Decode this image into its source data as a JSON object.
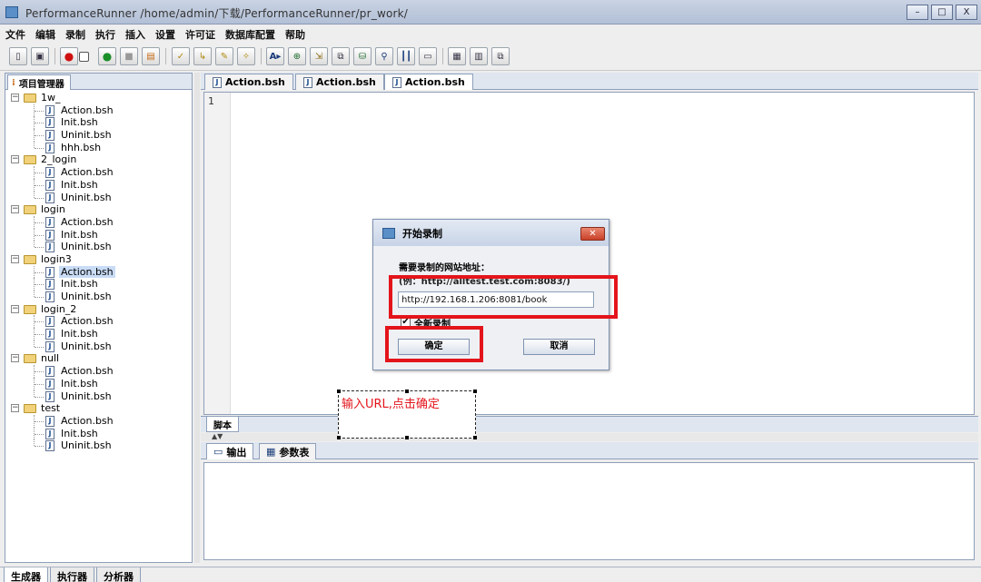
{
  "window": {
    "title": "PerformanceRunner  /home/admin/下载/PerformanceRunner/pr_work/",
    "controls": [
      "–",
      "□",
      "X"
    ]
  },
  "menu": [
    "文件",
    "编辑",
    "录制",
    "执行",
    "插入",
    "设置",
    "许可证",
    "数据库配置",
    "帮助"
  ],
  "toolbar": {
    "buttons": [
      "new-file-icon",
      "save-icon",
      "record-icon",
      "run-icon",
      "stop-icon",
      "export-icon",
      "check-icon",
      "transaction-icon",
      "rendezvous-icon",
      "think-time-icon",
      "text-check-icon",
      "parameter-icon",
      "insert-icon",
      "function-icon",
      "sql-icon",
      "link-icon",
      "chart-icon",
      "comment-icon",
      "properties-icon",
      "settings-icon",
      "copy-icon"
    ],
    "text_button": "A▸"
  },
  "project_panel": {
    "tab_label": "项目管理器",
    "tree": [
      {
        "folder": "1w_",
        "files": [
          "Action.bsh",
          "Init.bsh",
          "Uninit.bsh",
          "hhh.bsh"
        ]
      },
      {
        "folder": "2_login",
        "files": [
          "Action.bsh",
          "Init.bsh",
          "Uninit.bsh"
        ]
      },
      {
        "folder": "login",
        "files": [
          "Action.bsh",
          "Init.bsh",
          "Uninit.bsh"
        ]
      },
      {
        "folder": "login3",
        "files": [
          "Action.bsh",
          "Init.bsh",
          "Uninit.bsh"
        ]
      },
      {
        "folder": "login_2",
        "files": [
          "Action.bsh",
          "Init.bsh",
          "Uninit.bsh"
        ]
      },
      {
        "folder": "null",
        "files": [
          "Action.bsh",
          "Init.bsh",
          "Uninit.bsh"
        ]
      },
      {
        "folder": "test",
        "files": [
          "Action.bsh",
          "Init.bsh",
          "Uninit.bsh"
        ]
      }
    ],
    "selected": "login3/Action.bsh"
  },
  "editor": {
    "tabs": [
      "Action.bsh",
      "Action.bsh",
      "Action.bsh"
    ],
    "active_tab": 2,
    "line_number": "1",
    "bottom_tab": "脚本"
  },
  "output": {
    "tabs": [
      "输出",
      "参数表"
    ]
  },
  "bottom_tabs": [
    "生成器",
    "执行器",
    "分析器"
  ],
  "dialog": {
    "title": "开始录制",
    "label": "需要录制的网站地址：",
    "example": "(例：http://alltest.test.com:8083/)",
    "url_value": "http://192.168.1.206:8081/book",
    "checkbox_label": "全新录制",
    "checkbox_checked": true,
    "ok_label": "确定",
    "cancel_label": "取消",
    "close_label": "✕"
  },
  "annotation": {
    "text": "输入URL,点击确定",
    "color": "#e4141b"
  }
}
